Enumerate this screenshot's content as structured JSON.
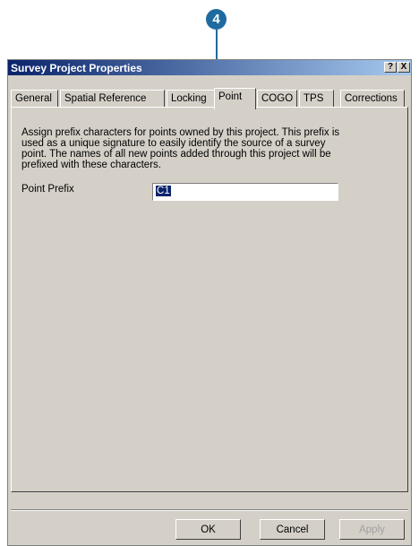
{
  "callout": {
    "number": "4"
  },
  "window": {
    "title": "Survey Project Properties",
    "help_button": "?",
    "close_button": "X"
  },
  "tabs": [
    {
      "label": "General"
    },
    {
      "label": "Spatial Reference"
    },
    {
      "label": "Locking"
    },
    {
      "label": "Point",
      "active": true
    },
    {
      "label": "COGO"
    },
    {
      "label": "TPS"
    },
    {
      "label": "Corrections"
    }
  ],
  "point_tab": {
    "description": "Assign prefix characters for points owned by this project.  This prefix is used as a unique signature to easily identify the source of a survey point. The names of all new points added through this project will be prefixed with these characters.",
    "prefix_label": "Point Prefix",
    "prefix_value": "C1"
  },
  "buttons": {
    "ok": "OK",
    "cancel": "Cancel",
    "apply": "Apply"
  }
}
